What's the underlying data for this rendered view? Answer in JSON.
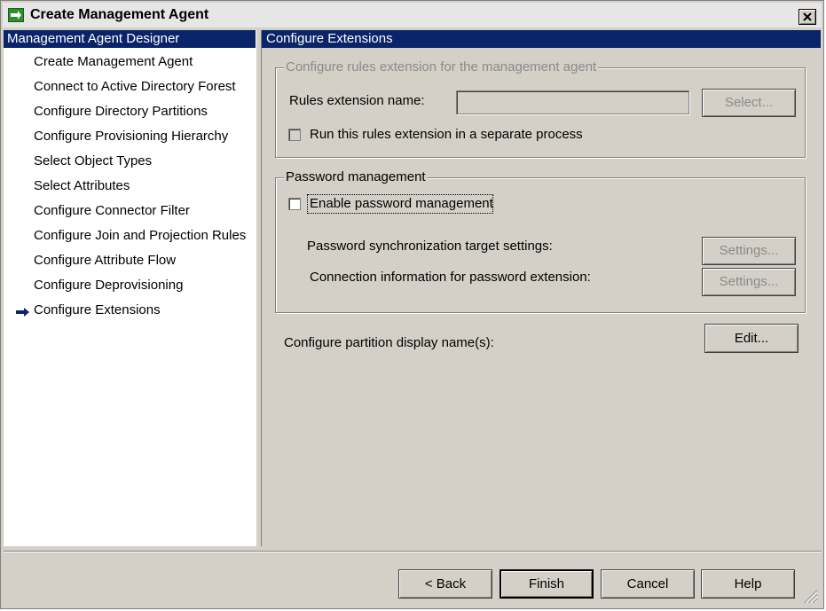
{
  "window": {
    "title": "Create Management Agent",
    "icon": "management-agent-icon",
    "close_icon": "close-icon"
  },
  "left_pane": {
    "header": "Management Agent Designer",
    "items": [
      {
        "label": "Create Management Agent",
        "current": false
      },
      {
        "label": "Connect to Active Directory Forest",
        "current": false
      },
      {
        "label": "Configure Directory Partitions",
        "current": false
      },
      {
        "label": "Configure Provisioning Hierarchy",
        "current": false
      },
      {
        "label": "Select Object Types",
        "current": false
      },
      {
        "label": "Select Attributes",
        "current": false
      },
      {
        "label": "Configure Connector Filter",
        "current": false
      },
      {
        "label": "Configure Join and Projection Rules",
        "current": false
      },
      {
        "label": "Configure Attribute Flow",
        "current": false
      },
      {
        "label": "Configure Deprovisioning",
        "current": false
      },
      {
        "label": "Configure Extensions",
        "current": true
      }
    ],
    "current_indicator_icon": "arrow-right-icon"
  },
  "right_pane": {
    "header": "Configure Extensions",
    "rules_group": {
      "legend": "Configure rules extension for the management agent",
      "name_label": "Rules extension name:",
      "name_value": "",
      "select_button": "Select...",
      "separate_process_label": "Run this rules extension in a separate process",
      "separate_process_checked": false,
      "enabled": false
    },
    "password_group": {
      "legend": "Password management",
      "enable_label": "Enable password management",
      "enable_checked": false,
      "sync_target_label": "Password synchronization target settings:",
      "sync_target_button": "Settings...",
      "connection_label": "Connection information for password extension:",
      "connection_button": "Settings..."
    },
    "partition_label": "Configure partition display name(s):",
    "partition_button": "Edit..."
  },
  "footer": {
    "back": "< Back",
    "finish": "Finish",
    "cancel": "Cancel",
    "help": "Help"
  }
}
